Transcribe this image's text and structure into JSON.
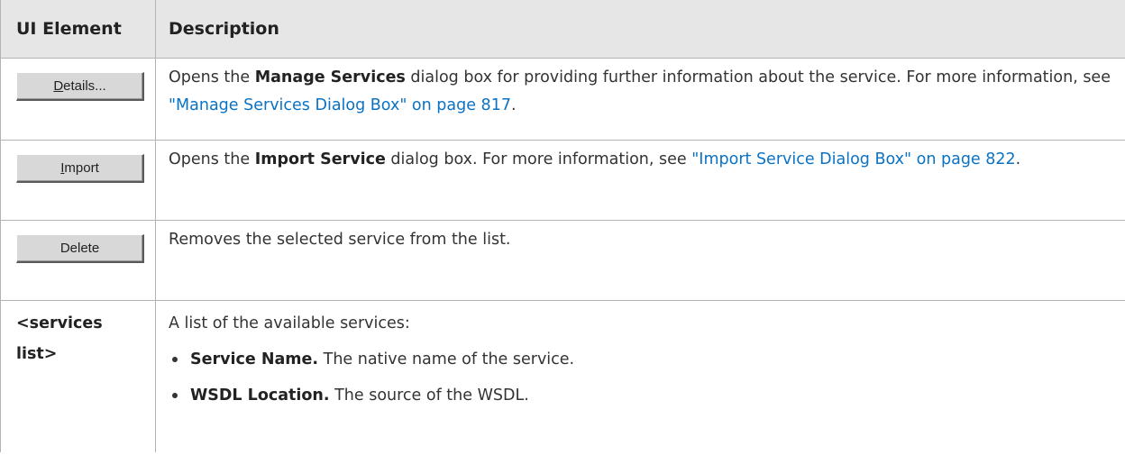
{
  "table": {
    "headers": [
      "UI Element",
      "Description"
    ],
    "rows": [
      {
        "button_label": "Details...",
        "button_mnemonic": "D",
        "description": {
          "before": "Opens the ",
          "bold": "Manage Services",
          "middle": " dialog box for providing further information about the service. For more information, see ",
          "link": "\"Manage Services Dialog Box\" on page 817",
          "after": "."
        }
      },
      {
        "button_label": "Import",
        "button_mnemonic": "I",
        "description": {
          "before": "Opens the ",
          "bold": "Import Service",
          "middle": " dialog box. For more information, see ",
          "link": "\"Import Service Dialog Box\" on page 822",
          "after": "."
        }
      },
      {
        "button_label": "Delete",
        "description": {
          "text": "Removes the selected service from the list."
        }
      },
      {
        "element_label": "<services list>",
        "description": {
          "intro": "A list of the available services:",
          "bullets": [
            {
              "term": "Service Name.",
              "text": " The native name of the service."
            },
            {
              "term": "WSDL Location.",
              "text": " The source of the WSDL."
            }
          ]
        }
      }
    ]
  },
  "colors": {
    "header_background": "#e6e6e6",
    "link": "#0a72c4",
    "border": "#b3b3b3",
    "text": "#333333"
  }
}
